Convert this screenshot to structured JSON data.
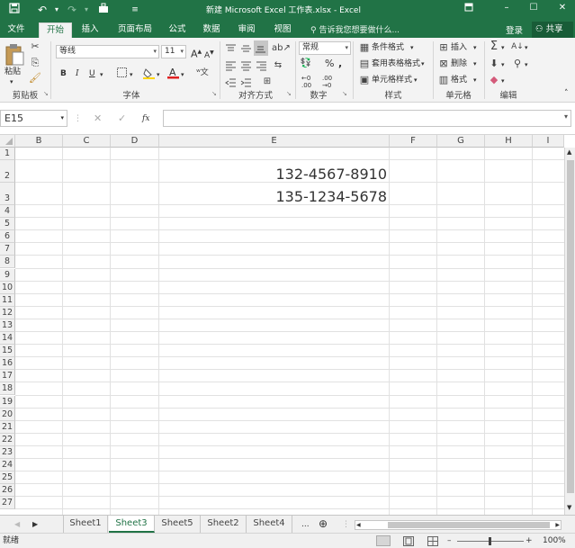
{
  "titlebar": {
    "title": "新建 Microsoft Excel 工作表.xlsx - Excel",
    "qat_icons": [
      "save-icon",
      "undo-icon",
      "redo-icon",
      "touch-mode-icon",
      "customize-qat-icon"
    ],
    "window_icons": [
      "ribbon-display-icon",
      "minimize-icon",
      "maximize-icon",
      "close-icon"
    ]
  },
  "tabs": [
    "文件",
    "开始",
    "插入",
    "页面布局",
    "公式",
    "数据",
    "审阅",
    "视图"
  ],
  "active_tab": "开始",
  "tell_me": "告诉我您想要做什么...",
  "account": {
    "login": "登录",
    "share": "共享"
  },
  "ribbon": {
    "clipboard": {
      "label": "剪贴板",
      "paste": "粘贴"
    },
    "font": {
      "label": "字体",
      "name": "等线",
      "size": "11",
      "bold": "B",
      "italic": "I",
      "underline": "U",
      "grow": "A",
      "shrink": "A"
    },
    "alignment": {
      "label": "对齐方式"
    },
    "number": {
      "label": "数字",
      "format": "常规",
      "percent": "%"
    },
    "styles": {
      "label": "样式",
      "conditional": "条件格式",
      "table": "套用表格格式",
      "cell_styles": "单元格样式"
    },
    "cells": {
      "label": "单元格",
      "insert": "插入",
      "delete": "删除",
      "format": "格式"
    },
    "editing": {
      "label": "编辑"
    }
  },
  "formula_bar": {
    "name_box": "E15",
    "cancel": "✕",
    "enter": "✓",
    "fx": "fx",
    "content": ""
  },
  "grid": {
    "columns": [
      "B",
      "C",
      "D",
      "E",
      "F",
      "G",
      "H",
      "I"
    ],
    "rows": [
      "1",
      "2",
      "3",
      "4",
      "5",
      "6",
      "7",
      "8",
      "9",
      "10",
      "11",
      "12",
      "13",
      "14",
      "15",
      "16",
      "17",
      "18",
      "19",
      "20",
      "21",
      "22",
      "23",
      "24",
      "25",
      "26",
      "27"
    ],
    "cells": [
      {
        "ref": "E2",
        "value": "132-4567-8910"
      },
      {
        "ref": "E3",
        "value": "135-1234-5678"
      }
    ]
  },
  "sheets": [
    "Sheet1",
    "Sheet3",
    "Sheet5",
    "Sheet2",
    "Sheet4"
  ],
  "active_sheet": "Sheet3",
  "sheet_more": "...",
  "status": {
    "mode": "就绪",
    "zoom": "100%"
  },
  "colors": {
    "brand": "#217346",
    "ribbon": "#f3f3f3",
    "gridline": "#e1e1e1"
  }
}
